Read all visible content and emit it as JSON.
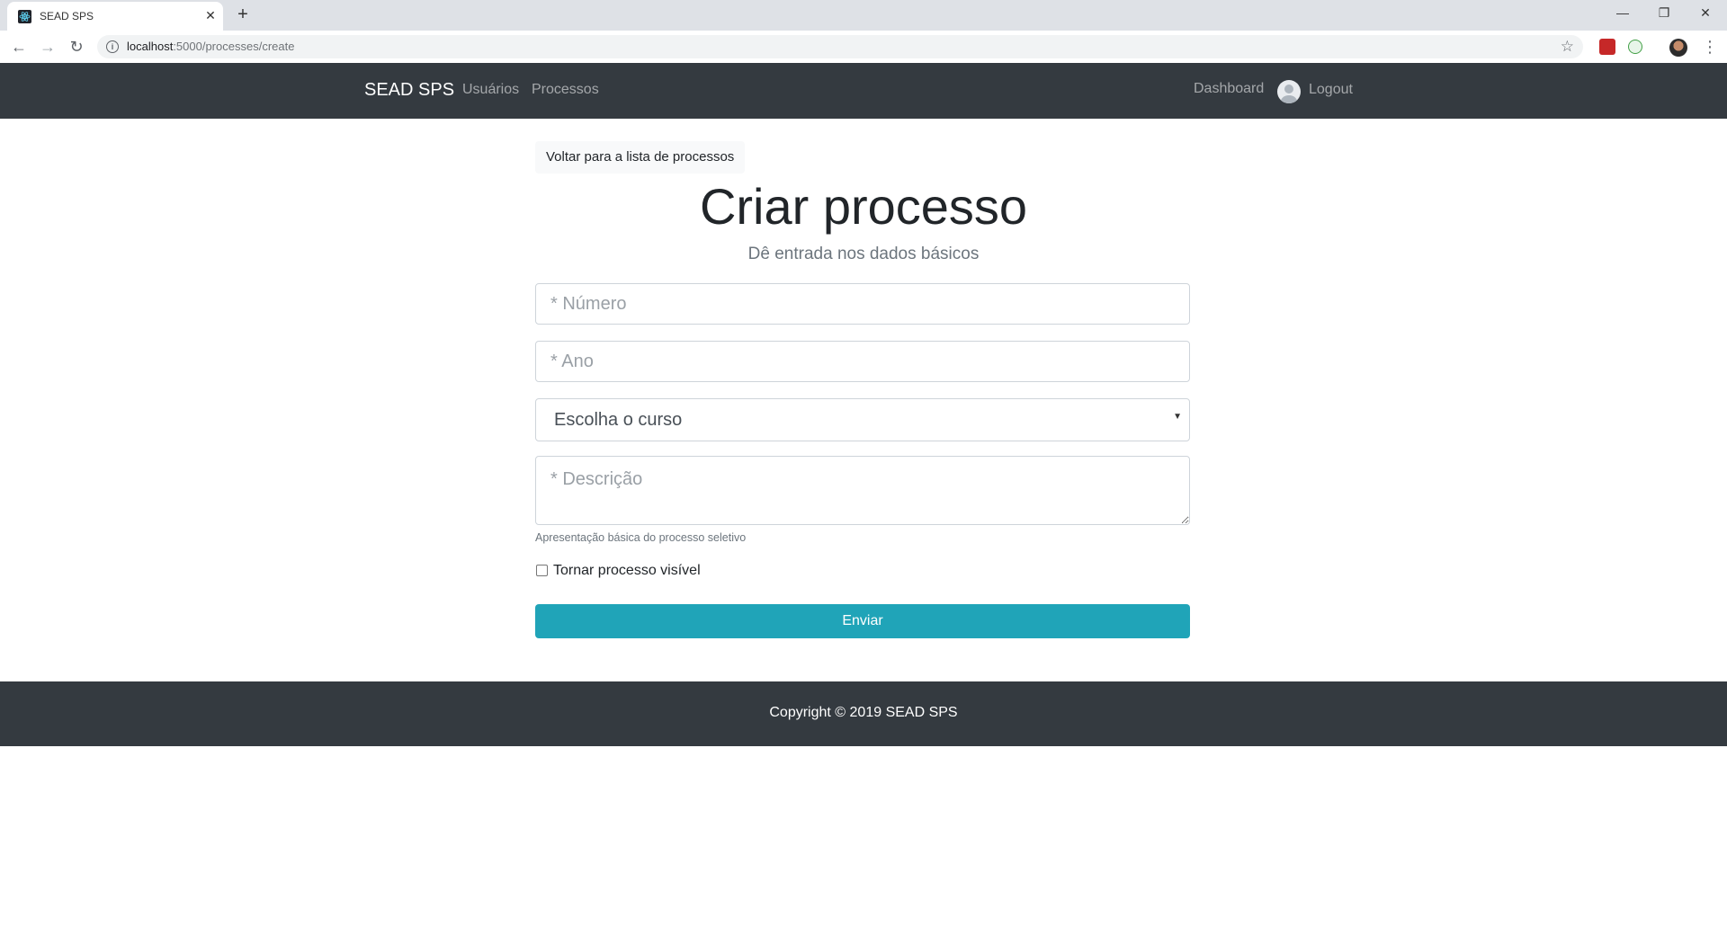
{
  "browser": {
    "tab_title": "SEAD SPS",
    "tab_close": "✕",
    "new_tab": "+",
    "url_host": "localhost",
    "url_path": ":5000/processes/create",
    "window_controls": {
      "minimize": "—",
      "restore": "❐",
      "close": "✕"
    },
    "nav": {
      "back": "←",
      "forward": "→",
      "reload": "↻"
    }
  },
  "navbar": {
    "brand": "SEAD SPS",
    "links": [
      "Usuários",
      "Processos"
    ],
    "dashboard": "Dashboard",
    "logout": "Logout"
  },
  "form": {
    "back_label": "Voltar para a lista de processos",
    "title": "Criar processo",
    "subtitle": "Dê entrada nos dados básicos",
    "numero_placeholder": "* Número",
    "ano_placeholder": "* Ano",
    "curso_selected": "Escolha o curso",
    "descricao_placeholder": "* Descrição",
    "descricao_help": "Apresentação básica do processo seletivo",
    "visible_label": "Tornar processo visível",
    "visible_checked": false,
    "submit_label": "Enviar"
  },
  "footer": {
    "copyright": "Copyright © 2019 SEAD SPS"
  },
  "colors": {
    "navbar_bg": "#343a40",
    "submit_bg": "#20a4b8",
    "page_bg": "#ffffff"
  }
}
